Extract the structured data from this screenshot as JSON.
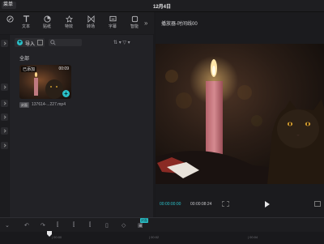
{
  "topbar": {
    "menu_label": "菜单",
    "date": "12月4日"
  },
  "toolbar": {
    "tools": [
      {
        "label": "",
        "icon": "media-icon"
      },
      {
        "label": "文本",
        "icon": "text-icon"
      },
      {
        "label": "贴纸",
        "icon": "sticker-icon"
      },
      {
        "label": "特效",
        "icon": "effects-icon"
      },
      {
        "label": "转场",
        "icon": "transition-icon"
      },
      {
        "label": "字幕",
        "icon": "caption-icon"
      },
      {
        "label": "智能",
        "icon": "smart-icon"
      }
    ],
    "more": "»"
  },
  "media": {
    "import_label": "导入",
    "all_label": "全部",
    "sort_icons": "⇅ ▾   ▽ ▾",
    "clip": {
      "badge": "已添加",
      "duration": "00:09",
      "file_tag": "封面",
      "file_name": "137614-...227.mp4"
    }
  },
  "player": {
    "title": "播放器-时间线00",
    "time_current": "00:00:00:00",
    "time_total": "00:00:08:24"
  },
  "timeline": {
    "cover_tag": "封面",
    "ruler_ticks": [
      "| 00:00",
      "| 00:02",
      "| 00:04"
    ]
  },
  "colors": {
    "accent": "#2bc0c8",
    "background": "#1a1a1d"
  }
}
